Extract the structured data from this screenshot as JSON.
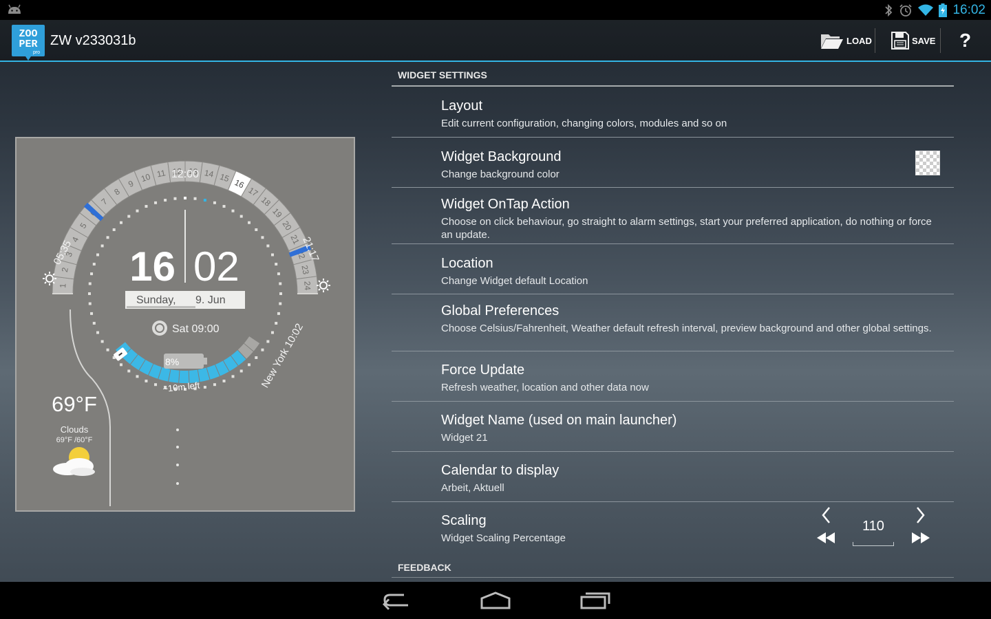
{
  "status_bar": {
    "time": "16:02",
    "icons": [
      "android-icon",
      "bluetooth-icon",
      "alarm-icon",
      "wifi-icon",
      "battery-charging-icon"
    ],
    "accent": "#33b5e5"
  },
  "action_bar": {
    "logo_text_top": "ZOO",
    "logo_text_mid": "PER",
    "logo_text_bottom": "pro",
    "title": "ZW v233031b",
    "load_label": "LOAD",
    "save_label": "SAVE",
    "help_label": "?"
  },
  "widget_preview": {
    "top_time_label": "12:00",
    "hour": "16",
    "minute": "02",
    "day": "Sunday,",
    "date": "9. Jun",
    "alarm": "Sat 09:00",
    "sunrise": "05:35",
    "sunset": "21:17",
    "battery_percent": "8%",
    "battery_remaining": "~10m left",
    "city_time": "New York 10:02",
    "temperature": "69°F",
    "condition": "Clouds",
    "hi_lo": "69°F /60°F",
    "hours": [
      "1",
      "2",
      "3",
      "4",
      "5",
      "6",
      "7",
      "8",
      "9",
      "10",
      "11",
      "12",
      "13",
      "14",
      "15",
      "16",
      "17",
      "18",
      "19",
      "20",
      "21",
      "22",
      "23",
      "24"
    ],
    "current_hour": "16",
    "daylight_start_hour": 5.58,
    "daylight_end_hour": 21.28,
    "battery_level": 0.08,
    "colors": {
      "battery": "#3cb8e6",
      "daylight_marker": "#2f6fd6",
      "background": "#7f7e7b"
    }
  },
  "settings": {
    "section_widget": "WIDGET SETTINGS",
    "section_feedback": "FEEDBACK",
    "items": [
      {
        "title": "Layout",
        "summary": "Edit current configuration, changing colors, modules and so on"
      },
      {
        "title": "Widget Background",
        "summary": "Change background color"
      },
      {
        "title": "Widget OnTap Action",
        "summary": "Choose on click behaviour, go straight to alarm settings, start your preferred application, do nothing or force an update."
      },
      {
        "title": "Location",
        "summary": "Change Widget default Location"
      },
      {
        "title": "Global Preferences",
        "summary": "Choose Celsius/Fahrenheit, Weather default refresh interval, preview background and other global settings."
      },
      {
        "title": "Force Update",
        "summary": "Refresh weather, location and other data now"
      },
      {
        "title": "Widget Name (used on main launcher)",
        "summary": "Widget 21"
      },
      {
        "title": "Calendar to display",
        "summary": "Arbeit, Aktuell"
      },
      {
        "title": "Scaling",
        "summary": "Widget Scaling Percentage"
      }
    ],
    "scaling_value": "110"
  },
  "nav_bar": {
    "icons": [
      "back-icon",
      "home-icon",
      "recent-apps-icon"
    ]
  }
}
